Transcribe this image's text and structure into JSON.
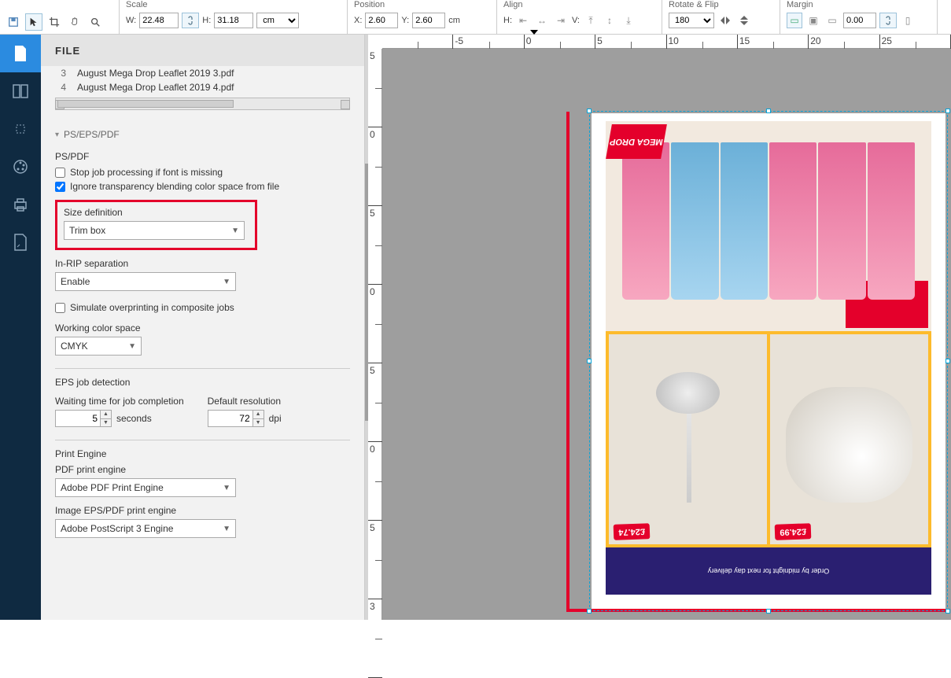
{
  "toolbar": {
    "scale": {
      "label": "Scale",
      "w_label": "W:",
      "w": "22.48",
      "h_label": "H:",
      "h": "31.18",
      "unit": "cm"
    },
    "position": {
      "label": "Position",
      "x_label": "X:",
      "x": "2.60",
      "y_label": "Y:",
      "y": "2.60",
      "unit": "cm"
    },
    "align": {
      "label": "Align",
      "h_label": "H:",
      "v_label": "V:"
    },
    "rotate": {
      "label": "Rotate & Flip",
      "angle": "180"
    },
    "margin": {
      "label": "Margin",
      "value": "0.00"
    }
  },
  "panel": {
    "title": "FILE",
    "files": [
      {
        "n": "3",
        "name": "August Mega Drop Leaflet 2019 3.pdf"
      },
      {
        "n": "4",
        "name": "August Mega Drop Leaflet 2019 4.pdf"
      }
    ],
    "section_title": "PS/EPS/PDF",
    "pspdf_label": "PS/PDF",
    "stop_font": "Stop job processing if font is missing",
    "ignore_trans": "Ignore transparency blending color space from file",
    "size_def_label": "Size definition",
    "size_def_value": "Trim box",
    "inrip_label": "In-RIP separation",
    "inrip_value": "Enable",
    "simulate_over": "Simulate overprinting in composite jobs",
    "wcs_label": "Working color space",
    "wcs_value": "CMYK",
    "eps_hd": "EPS job detection",
    "wait_label": "Waiting time for job completion",
    "wait_value": "5",
    "wait_unit": "seconds",
    "defres_label": "Default resolution",
    "defres_value": "72",
    "defres_unit": "dpi",
    "pe_hd": "Print Engine",
    "pdf_pe_label": "PDF print engine",
    "pdf_pe_value": "Adobe PDF Print Engine",
    "eps_pe_label": "Image EPS/PDF print engine",
    "eps_pe_value": "Adobe PostScript 3 Engine"
  },
  "ruler_h": [
    "",
    "-5",
    "0",
    "5",
    "10",
    "15",
    "20",
    "25"
  ],
  "ruler_v": [
    "5",
    "0",
    "5",
    "0",
    "5",
    "0",
    "5",
    "3"
  ],
  "artwork": {
    "price1": "£24.99",
    "price2": "£24.74",
    "mega": "MEGA DROP",
    "promo": "Order by midnight for next day delivery"
  }
}
